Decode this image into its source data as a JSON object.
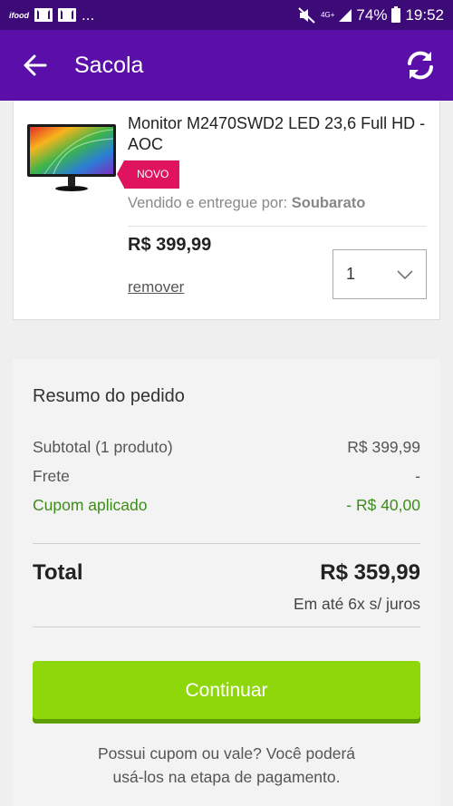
{
  "status_bar": {
    "left_label": "ifood",
    "dots": "...",
    "network": "4G+",
    "battery": "74%",
    "time": "19:52"
  },
  "app_bar": {
    "title": "Sacola",
    "back_icon": "arrow-left-icon",
    "refresh_icon": "refresh-icon"
  },
  "product": {
    "name": "Monitor M2470SWD2 LED 23,6 Full HD - AOC",
    "badge": "NOVO",
    "seller_prefix": "Vendido e entregue por:",
    "seller_name": "Soubarato",
    "price": "R$ 399,99",
    "remove_label": "remover",
    "quantity": "1"
  },
  "summary": {
    "title": "Resumo do pedido",
    "rows": [
      {
        "label": "Subtotal (1 produto)",
        "value": "R$ 399,99"
      },
      {
        "label": "Frete",
        "value": "-"
      },
      {
        "label": "Cupom aplicado",
        "value": "- R$ 40,00"
      }
    ],
    "total_label": "Total",
    "total_value": "R$ 359,99",
    "installments": "Em até 6x s/ juros",
    "continue_label": "Continuar",
    "coupon_note_line1": "Possui cupom ou vale? Você poderá",
    "coupon_note_line2": "usá-los na etapa de pagamento."
  },
  "colors": {
    "app_bar": "#5a0fa9",
    "status_bar": "#3d0b78",
    "badge": "#e0145e",
    "coupon": "#3d8b1b",
    "continue_button": "#8ed70b"
  }
}
